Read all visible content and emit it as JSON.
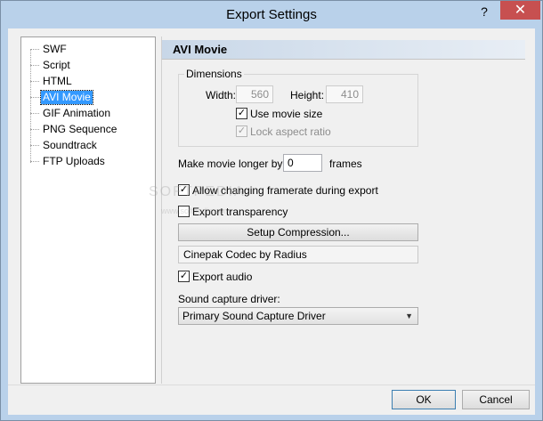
{
  "window": {
    "title": "Export Settings",
    "help_glyph": "?",
    "close_glyph": "✕"
  },
  "tree": {
    "items": [
      {
        "label": "SWF"
      },
      {
        "label": "Script"
      },
      {
        "label": "HTML"
      },
      {
        "label": "AVI Movie",
        "selected": true
      },
      {
        "label": "GIF Animation"
      },
      {
        "label": "PNG Sequence"
      },
      {
        "label": "Soundtrack"
      },
      {
        "label": "FTP Uploads"
      }
    ]
  },
  "panel": {
    "title": "AVI Movie",
    "dimensions": {
      "legend": "Dimensions",
      "width_label": "Width:",
      "width_value": "560",
      "height_label": "Height:",
      "height_value": "410",
      "use_movie_size_label": "Use movie size",
      "use_movie_size_checked": true,
      "lock_aspect_label": "Lock aspect ratio",
      "lock_aspect_checked": true
    },
    "longer": {
      "label": "Make movie longer by:",
      "value": "0",
      "unit": "frames"
    },
    "allow_framerate": {
      "label": "Allow changing framerate during export",
      "checked": true
    },
    "export_transparency": {
      "label": "Export transparency",
      "checked": false
    },
    "setup_compression_label": "Setup Compression...",
    "codec_text": "Cinepak Codec by Radius",
    "export_audio": {
      "label": "Export audio",
      "checked": true
    },
    "sound_driver": {
      "label": "Sound capture driver:",
      "selected": "Primary Sound Capture Driver"
    }
  },
  "footer": {
    "ok_label": "OK",
    "cancel_label": "Cancel"
  },
  "watermark": {
    "text": "SOFTPEDIA",
    "sub": "www.softpedia.com"
  },
  "colors": {
    "titlebar": "#b9d1ea",
    "close_button": "#c75050",
    "selection": "#3399ff"
  }
}
